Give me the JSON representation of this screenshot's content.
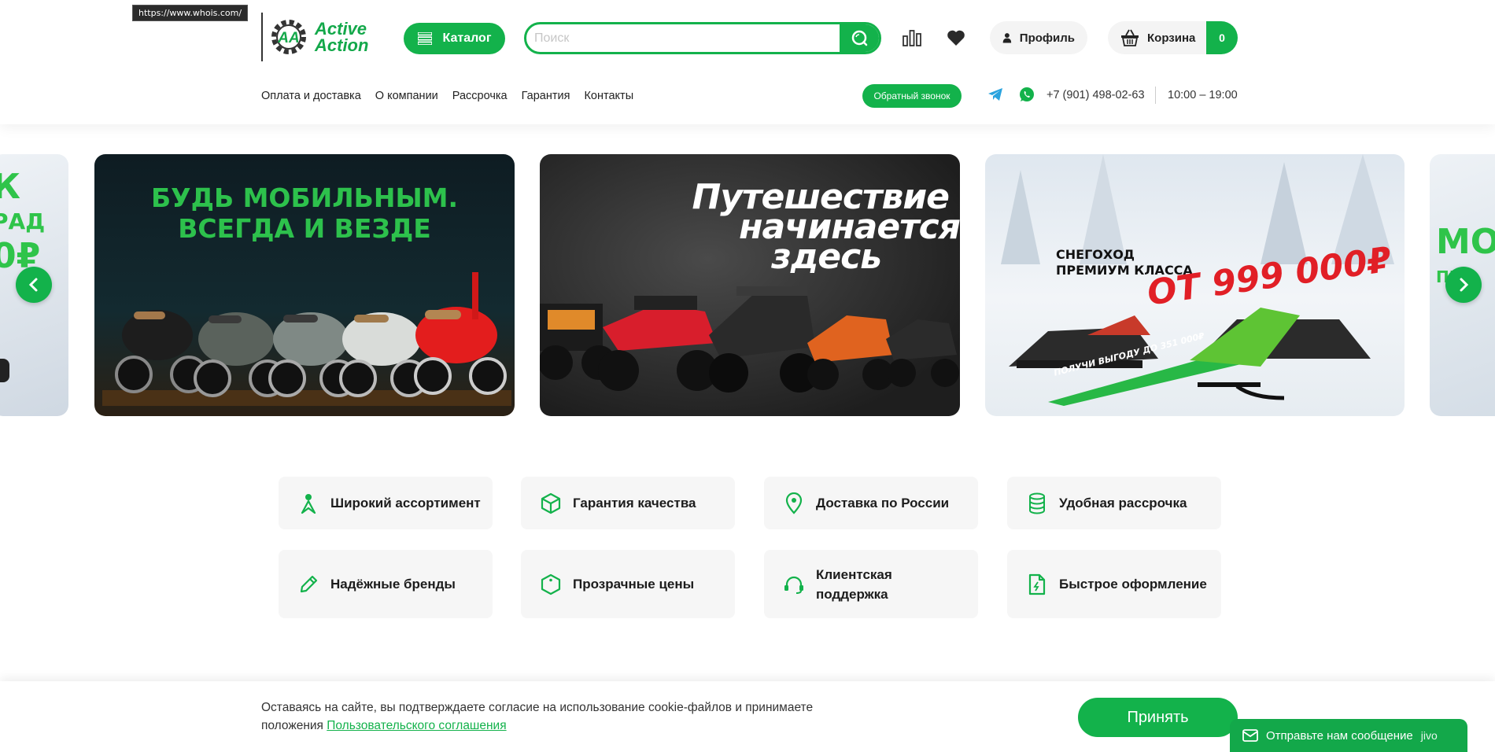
{
  "tooltip": {
    "url": "https://www.whois.com/"
  },
  "brand": {
    "line1": "Active",
    "line2": "Action",
    "monogram": "AA",
    "color": "#13b24b"
  },
  "header": {
    "catalog_label": "Каталог",
    "search_placeholder": "Поиск",
    "search_value": "",
    "profile_label": "Профиль",
    "cart_label": "Корзина",
    "cart_count": "0"
  },
  "nav": {
    "items": [
      "Оплата и доставка",
      "О компании",
      "Рассрочка",
      "Гарантия",
      "Контакты"
    ],
    "callback_label": "Обратный звонок",
    "phone": "+7 (901) 498-02-63",
    "hours": "10:00 – 19:00"
  },
  "slides": [
    {
      "lines": [
        "К",
        "РАД",
        "0₽"
      ]
    },
    {
      "lines": [
        "БУДЬ МОБИЛЬНЫМ.",
        "ВСЕГДА И ВЕЗДЕ"
      ]
    },
    {
      "lines": [
        "Путешествие",
        "начинается",
        "здесь"
      ]
    },
    {
      "lines": [
        "СНЕГОХОД",
        "ПРЕМИУМ КЛАССА",
        "ОТ 999 000₽",
        "ПОЛУЧИ ВЫГОДУ  ДО 351 000₽"
      ]
    },
    {
      "lines": [
        "МОТ",
        "ПР"
      ]
    }
  ],
  "features": [
    {
      "icon": "person-icon",
      "label": "Широкий ассортимент"
    },
    {
      "icon": "cube-icon",
      "label": "Гарантия качества"
    },
    {
      "icon": "map-pin-icon",
      "label": "Доставка по России"
    },
    {
      "icon": "coins-icon",
      "label": "Удобная рассрочка"
    },
    {
      "icon": "pen-icon",
      "label": "Надёжные бренды"
    },
    {
      "icon": "tag-icon",
      "label": "Прозрачные цены"
    },
    {
      "icon": "headset-icon",
      "label": "Клиентская поддержка"
    },
    {
      "icon": "document-icon",
      "label": "Быстрое оформление"
    }
  ],
  "cookie": {
    "text": "Оставаясь на сайте, вы подтверждаете согласие на использование cookie-файлов и принимаете положения",
    "link": "Пользовательского соглашения",
    "accept_label": "Принять"
  },
  "jivo": {
    "label": "Отправьте нам сообщение",
    "brand": "jivo"
  }
}
